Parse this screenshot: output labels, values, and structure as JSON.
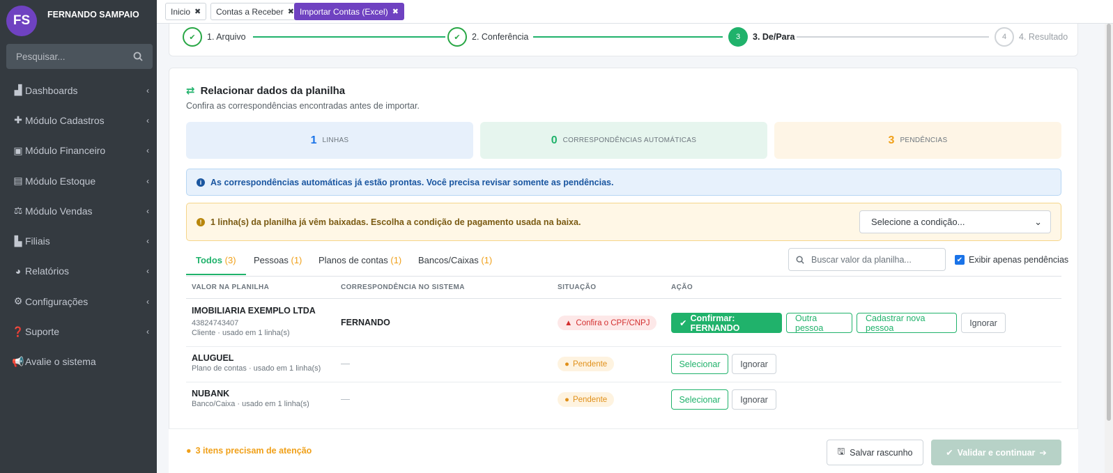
{
  "user": {
    "initials": "FS",
    "name": "FERNANDO SAMPAIO"
  },
  "search": {
    "placeholder": "Pesquisar..."
  },
  "menu": [
    {
      "label": "Dashboards",
      "icon": "chart-area-icon"
    },
    {
      "label": "Módulo Cadastros",
      "icon": "plus-icon"
    },
    {
      "label": "Módulo Financeiro",
      "icon": "money-icon"
    },
    {
      "label": "Módulo Estoque",
      "icon": "archive-icon"
    },
    {
      "label": "Módulo Vendas",
      "icon": "balance-scale-icon"
    },
    {
      "label": "Filiais",
      "icon": "bar-chart-icon"
    },
    {
      "label": "Relatórios",
      "icon": "pie-chart-icon"
    },
    {
      "label": "Configurações",
      "icon": "cogs-icon"
    },
    {
      "label": "Suporte",
      "icon": "question-icon"
    },
    {
      "label": "Avalie o sistema",
      "icon": "bullhorn-icon"
    }
  ],
  "tabs": [
    {
      "label": "Inicio"
    },
    {
      "label": "Contas a Receber"
    },
    {
      "label": "Importar Contas (Excel)"
    }
  ],
  "steps": [
    {
      "num": "1",
      "label": "1. Arquivo",
      "state": "done"
    },
    {
      "num": "2",
      "label": "2. Conferência",
      "state": "done"
    },
    {
      "num": "3",
      "label": "3. De/Para",
      "state": "current"
    },
    {
      "num": "4",
      "label": "4. Resultado",
      "state": "todo"
    }
  ],
  "header": {
    "title": "Relacionar dados da planilha",
    "subtitle": "Confira as correspondências encontradas antes de importar."
  },
  "stats": [
    {
      "value": "1",
      "label": "LINHAS",
      "color": "#1a73e8",
      "bg": "#e7f0fb"
    },
    {
      "value": "0",
      "label": "CORRESPONDÊNCIAS AUTOMÁTICAS",
      "color": "#20b26b",
      "bg": "#e6f5ee"
    },
    {
      "value": "3",
      "label": "PENDÊNCIAS",
      "color": "#f0a019",
      "bg": "#fef5e6"
    }
  ],
  "info": "As correspondências automáticas já estão prontas. Você precisa revisar somente as pendências.",
  "warning": {
    "text": "1 linha(s) da planilha já vêm baixadas. Escolha a condição de pagamento usada na baixa.",
    "select": "Selecione a condição..."
  },
  "filter_tabs": [
    {
      "label": "Todos",
      "count": "(3)"
    },
    {
      "label": "Pessoas",
      "count": "(1)"
    },
    {
      "label": "Planos de contas",
      "count": "(1)"
    },
    {
      "label": "Bancos/Caixas",
      "count": "(1)"
    }
  ],
  "table_search": {
    "placeholder": "Buscar valor da planilha..."
  },
  "only_pending": "Exibir apenas pendências",
  "columns": [
    "VALOR NA PLANILHA",
    "CORRESPONDÊNCIA NO SISTEMA",
    "SITUAÇÃO",
    "AÇÃO"
  ],
  "rows": [
    {
      "name": "IMOBILIARIA EXEMPLO LTDA",
      "doc": "43824743407",
      "meta": "Cliente · usado em 1 linha(s)",
      "match": "FERNANDO",
      "status": "Confira o CPF/CNPJ",
      "actions": [
        "Confirmar: FERNANDO",
        "Outra pessoa",
        "Cadastrar nova pessoa",
        "Ignorar"
      ]
    },
    {
      "name": "ALUGUEL",
      "meta": "Plano de contas · usado em 1 linha(s)",
      "match": "—",
      "status": "Pendente",
      "actions": [
        "Selecionar",
        "Ignorar"
      ]
    },
    {
      "name": "NUBANK",
      "meta": "Banco/Caixa · usado em 1 linha(s)",
      "match": "—",
      "status": "Pendente",
      "actions": [
        "Selecionar",
        "Ignorar"
      ]
    }
  ],
  "footer": {
    "attention": "3 itens precisam de atenção",
    "save": "Salvar rascunho",
    "next": "Validar e continuar"
  }
}
